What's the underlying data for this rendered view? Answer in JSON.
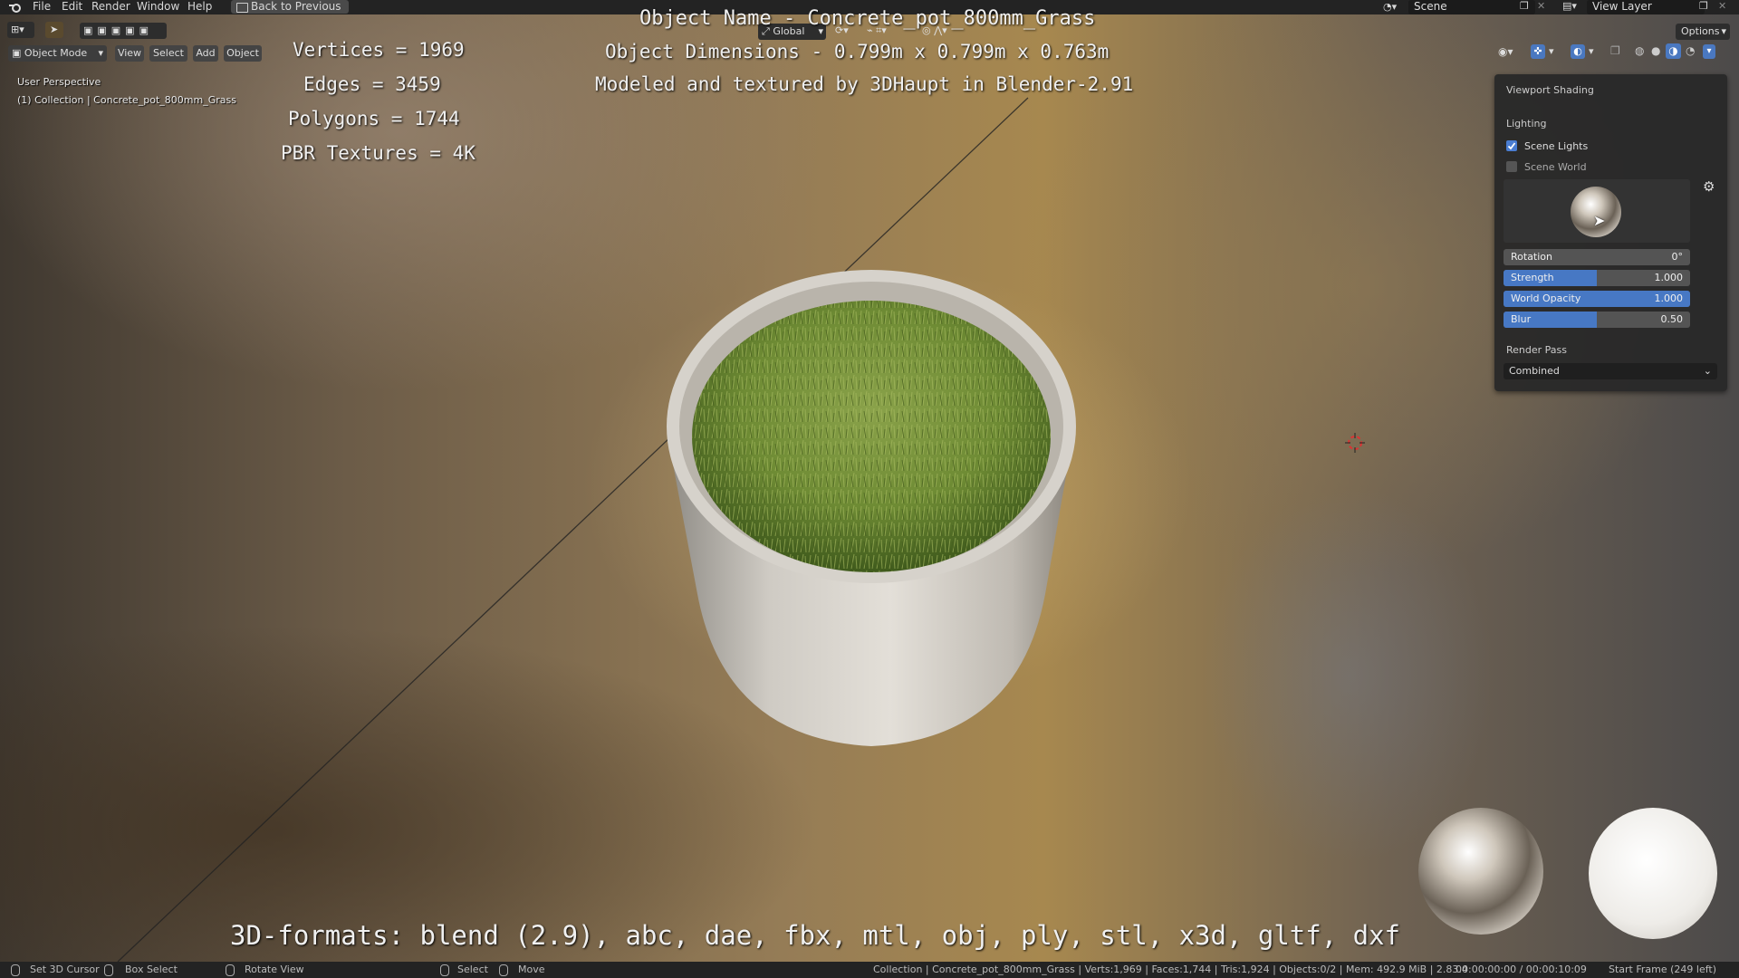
{
  "menubar": {
    "menus": [
      "File",
      "Edit",
      "Render",
      "Window",
      "Help"
    ],
    "back_button": "Back to Previous",
    "scene": "Scene",
    "view_layer": "View Layer"
  },
  "viewport_header": {
    "mode": "Object Mode",
    "menus": [
      "View",
      "Select",
      "Add",
      "Object"
    ],
    "orientation": "Global",
    "options": "Options"
  },
  "viewport_info": {
    "perspective": "User Perspective",
    "collection": "(1) Collection | Concrete_pot_800mm_Grass"
  },
  "overlay": {
    "object_name": "Object Name - Concrete_pot_800mm_Grass",
    "dimensions": "Object Dimensions -  0.799m x 0.799m x 0.763m",
    "credit": "Modeled and textured by 3DHaupt in Blender-2.91",
    "vertices": "Vertices = 1969",
    "edges": "Edges = 3459",
    "polygons": "Polygons = 1744",
    "textures": "PBR Textures = 4K",
    "formats": "3D-formats: blend (2.9), abc, dae, fbx, mtl, obj, ply, stl, x3d, gltf, dxf"
  },
  "shading_panel": {
    "title": "Viewport Shading",
    "lighting_label": "Lighting",
    "scene_lights": {
      "label": "Scene Lights",
      "checked": true
    },
    "scene_world": {
      "label": "Scene World",
      "checked": false
    },
    "rotation": {
      "label": "Rotation",
      "value": "0°",
      "fraction": 0
    },
    "strength": {
      "label": "Strength",
      "value": "1.000",
      "fraction": 0.5
    },
    "world_opacity": {
      "label": "World Opacity",
      "value": "1.000",
      "fraction": 1.0
    },
    "blur": {
      "label": "Blur",
      "value": "0.50",
      "fraction": 0.5
    },
    "render_pass_label": "Render Pass",
    "render_pass_value": "Combined"
  },
  "statusbar": {
    "set_cursor": "Set 3D Cursor",
    "box_select": "Box Select",
    "rotate_view": "Rotate View",
    "select": "Select",
    "move": "Move",
    "stats": "Collection | Concrete_pot_800mm_Grass | Verts:1,969 | Faces:1,744 | Tris:1,924 | Objects:0/2 | Mem: 492.9 MiB | 2.83.4",
    "time": "00:00:00:00 / 00:00:10:09",
    "frame": "Start Frame (249 left)"
  },
  "colors": {
    "accent": "#4778c4",
    "panel": "#282828",
    "bar": "#232323"
  }
}
